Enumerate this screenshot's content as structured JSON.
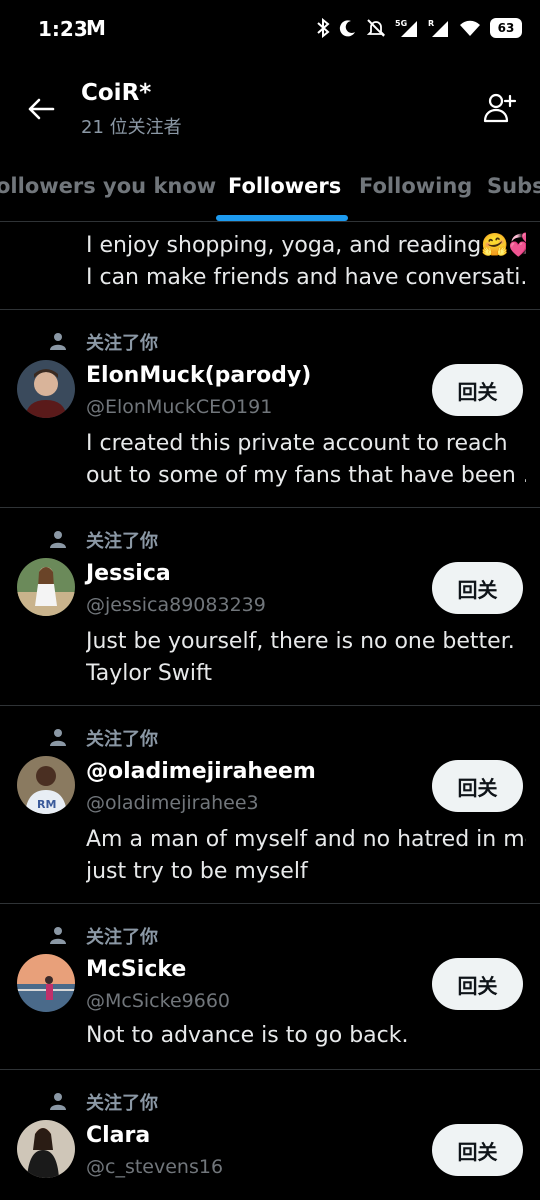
{
  "status_bar": {
    "time": "1:23",
    "mail_glyph": "M",
    "icons": [
      "bluetooth-icon",
      "moon-icon",
      "bell-muted-icon",
      "5g-signal-icon",
      "roaming-signal-icon",
      "wifi-icon"
    ],
    "battery": "63"
  },
  "header": {
    "title": "CoiR*",
    "subtitle": "21 位关注者"
  },
  "tabs": [
    {
      "label": "ollowers you know"
    },
    {
      "label": "Followers"
    },
    {
      "label": "Following"
    },
    {
      "label": "Subs"
    }
  ],
  "accent_color": "#1d9bf0",
  "partial_bio": {
    "line1": "I enjoy shopping, yoga, and reading🤗💞",
    "line2": "I can make friends and have conversati..."
  },
  "follow_back_label": "回关",
  "followers": [
    {
      "follows_you": "关注了你",
      "name": "ElonMuck(parody)",
      "handle": "@ElonMuckCEO191",
      "bio": [
        "I created this private account to reach",
        "out to some of my fans that have been ..."
      ]
    },
    {
      "follows_you": "关注了你",
      "name": "Jessica",
      "handle": "@jessica89083239",
      "bio": [
        "Just be yourself, there is no one better.",
        "Taylor Swift"
      ]
    },
    {
      "follows_you": "关注了你",
      "name": "@oladimejiraheem",
      "handle": "@oladimejirahee3",
      "bio": [
        "Am a man of myself and no hatred in me",
        "just try to be myself"
      ]
    },
    {
      "follows_you": "关注了你",
      "name": "McSicke",
      "handle": "@McSicke9660",
      "bio": [
        "Not to advance is to go back."
      ]
    },
    {
      "follows_you": "关注了你",
      "name": "Clara",
      "handle": "@c_stevens16",
      "bio": []
    }
  ]
}
